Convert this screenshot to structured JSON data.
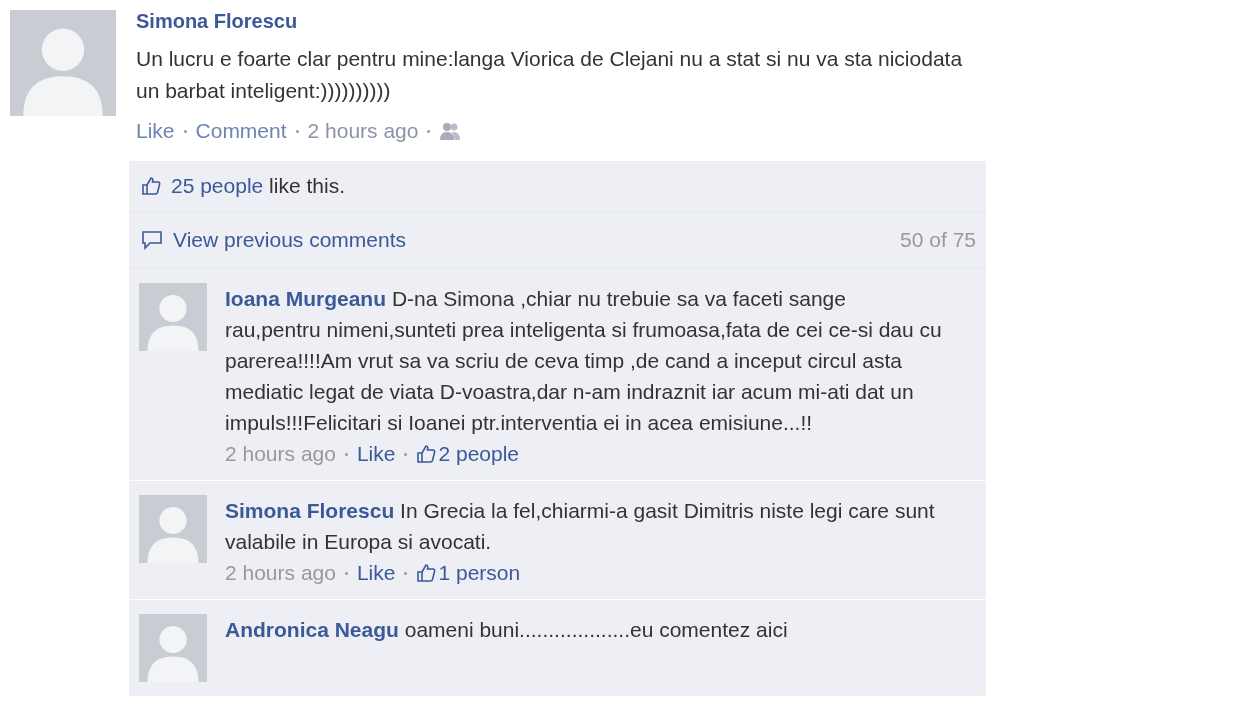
{
  "post": {
    "author": "Simona Florescu",
    "text": "Un lucru e foarte clar pentru mine:langa Viorica de Clejani nu a stat si nu va sta niciodata un barbat inteligent:))))))))))",
    "actions": [
      "Like",
      "Comment"
    ],
    "time": "2 hours ago"
  },
  "likes": {
    "people": "25 people",
    "suffix": "like this."
  },
  "view_previous": {
    "label": "View previous comments",
    "count": "50 of 75"
  },
  "comments": [
    {
      "author": "Ioana Murgeanu",
      "text": "D-na Simona ,chiar nu trebuie sa va faceti sange rau,pentru nimeni,sunteti prea inteligenta si frumoasa,fata de cei ce-si dau cu parerea!!!!Am vrut sa va scriu de ceva timp ,de cand a inceput circul asta mediatic legat de viata D-voastra,dar n-am indraznit iar acum mi-ati dat un impuls!!!Felicitari si Ioanei ptr.interventia ei in acea emisiune...!!",
      "time": "2 hours ago",
      "like": "Like",
      "likes": "2 people"
    },
    {
      "author": "Simona Florescu",
      "text": "In Grecia la fel,chiarmi-a gasit Dimitris niste legi care sunt valabile in Europa si avocati.",
      "time": "2 hours ago",
      "like": "Like",
      "likes": "1 person"
    },
    {
      "author": "Andronica Neagu",
      "text": "oameni buni...................eu comentez aici"
    }
  ]
}
